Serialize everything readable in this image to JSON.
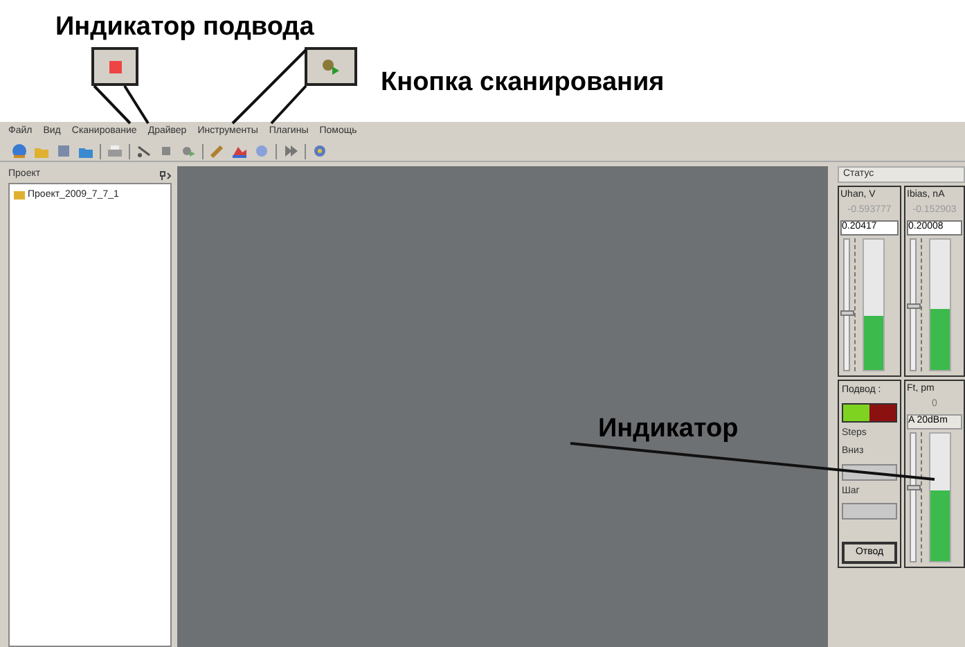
{
  "annotations": [
    {
      "text": "Индикатор подвода"
    },
    {
      "text": "Кнопка сканирования"
    },
    {
      "text": "Индикатор"
    }
  ],
  "menu": [
    "Файл",
    "Вид",
    "Сканирование",
    "Драйвер",
    "Инструменты",
    "Плагины",
    "Помощь"
  ],
  "project_panel": {
    "title": "Проект",
    "items": [
      "Проект_2009_7_7_1"
    ]
  },
  "status_panel": {
    "title": "Статус",
    "channels": [
      {
        "label": "Uhan, V",
        "reading": "-0.593777",
        "value": "0.20417",
        "level": 0.42
      },
      {
        "label": "Ibias, nA",
        "reading": "-0.152903",
        "value": "0.20008",
        "level": 0.47
      }
    ],
    "approach": {
      "label": "Подвод :",
      "indicators": [
        {
          "color": "#7ed321"
        },
        {
          "color": "#8b1010"
        }
      ],
      "steps_label": "Steps",
      "fields": [
        {
          "label": "Вниз"
        },
        {
          "label": "Шаг"
        }
      ],
      "button": "Отвод"
    },
    "ft": {
      "label": "Ft, pm",
      "reading": "0",
      "value": "A 20dBm",
      "level": 0.55
    }
  }
}
